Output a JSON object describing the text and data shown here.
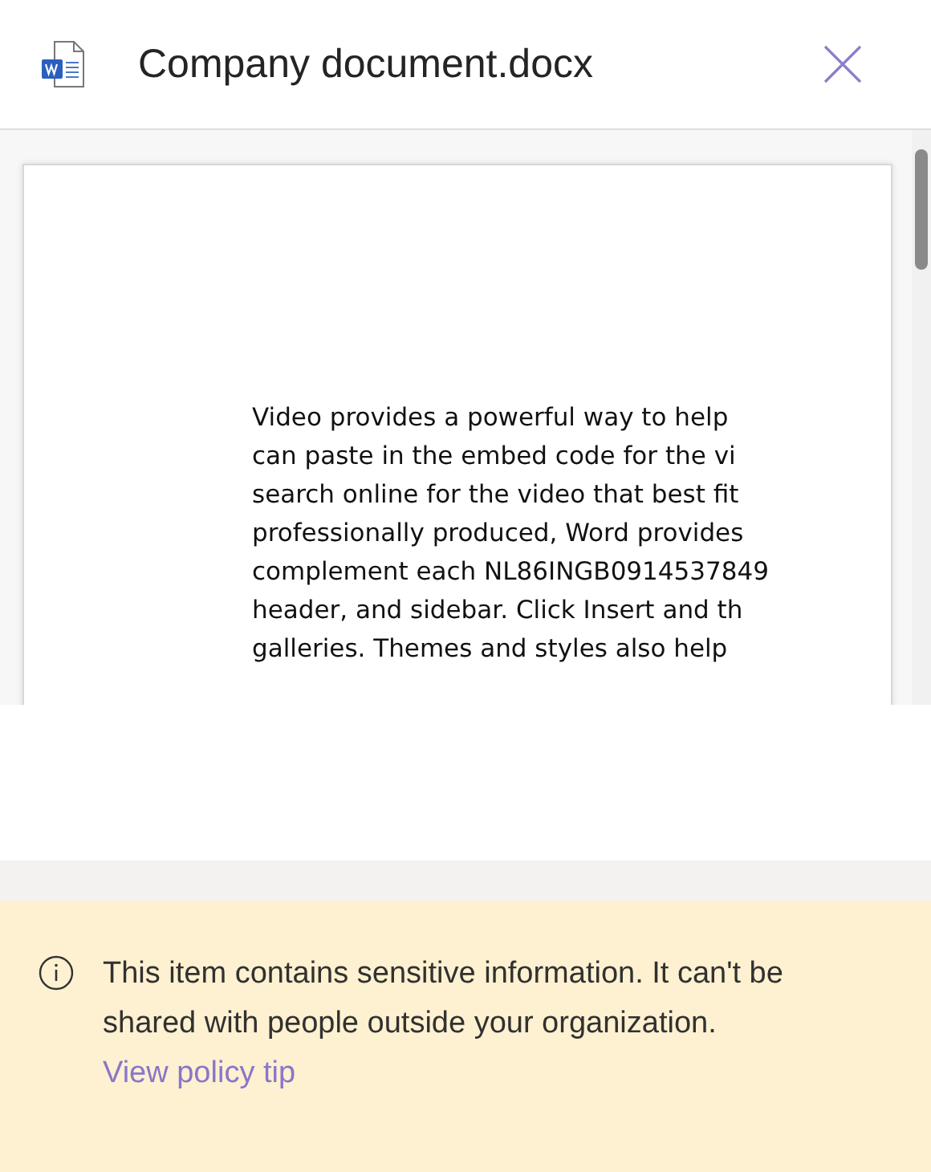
{
  "header": {
    "title": "Company document.docx"
  },
  "document": {
    "lines": [
      "Video provides a powerful way to help",
      "can paste in the embed code for the vi",
      "search online for the video that best fit",
      "professionally produced, Word provides",
      "complement each NL86INGB0914537849",
      "header, and sidebar. Click Insert and th",
      "galleries. Themes and styles also help"
    ]
  },
  "policy_tip": {
    "message": "This item contains sensitive information. It can't be shared with people outside your organization.",
    "link": "View policy tip"
  }
}
